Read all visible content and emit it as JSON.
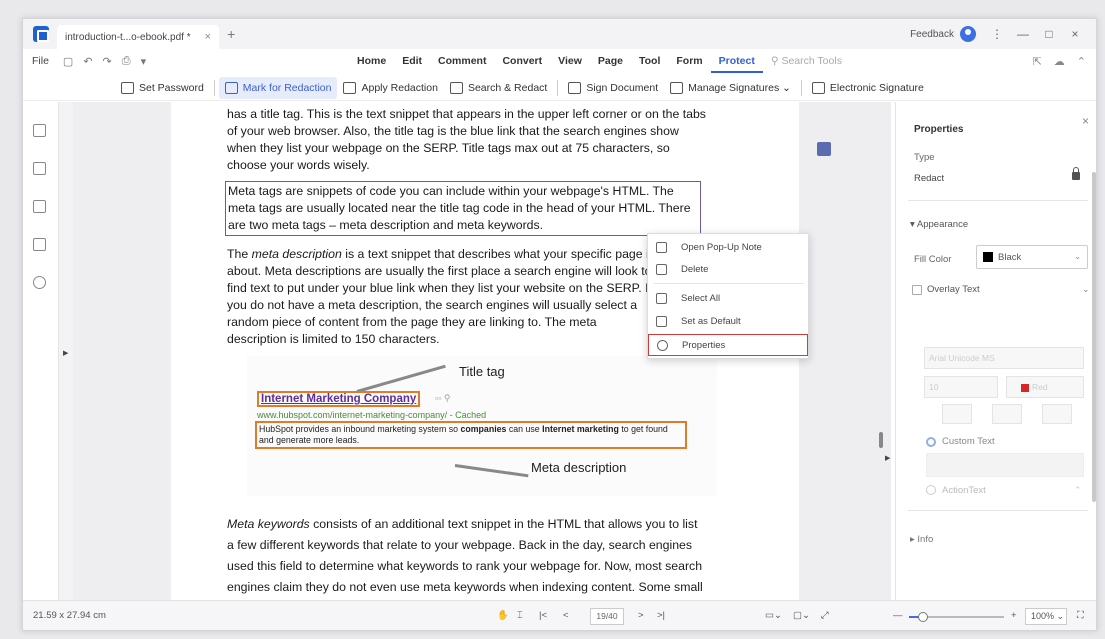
{
  "titlebar": {
    "tab_title": "introduction-t...o-ebook.pdf *",
    "tab_close": "×",
    "tab_add": "+",
    "feedback": "Feedback",
    "more": "⋮",
    "minimize": "—",
    "maximize": "□",
    "close": "×"
  },
  "menubar": {
    "file": "File",
    "items": [
      "Home",
      "Edit",
      "Comment",
      "Convert",
      "View",
      "Page",
      "Tool",
      "Form",
      "Protect"
    ],
    "active": "Protect",
    "search_tools": "Search Tools"
  },
  "ribbon": {
    "set_password": "Set Password",
    "mark_for_redaction": "Mark for Redaction",
    "apply_redaction": "Apply Redaction",
    "search_redact": "Search & Redact",
    "sign_document": "Sign Document",
    "manage_signatures": "Manage Signatures",
    "electronic_signature": "Electronic Signature"
  },
  "document": {
    "para1": "has a title tag. This is the text snippet that appears in the upper left corner or on the tabs of your web browser.  Also, the title tag is the blue link that the search engines show when they list your webpage on the SERP. Title tags max out at 75 characters, so choose your words wisely.",
    "para2": "Meta tags are snippets of code you can include within your webpage's HTML. The meta tags are usually located near the title tag code in the head of your HTML. There are two meta tags – meta description and meta keywords.",
    "para3_em": "meta description",
    "para3_pre": "The ",
    "para3_post": " is a text snippet that describes what your specific page is about. Meta descriptions are usually the first place a search engine will look to find text to put under your blue link when they list your website on the SERP. If you do not have a meta description, the search engines will usually select a random piece of content from the page they are linking to. The meta description is limited to 150 characters.",
    "para4_em": "Meta keywords",
    "para4_post": " consists of an additional text snippet in the HTML that allows you to list a few different keywords that relate to your webpage. Back in the day, search engines used this field to determine what keywords to rank your webpage for. Now, most search engines claim they do not even use meta keywords when indexing content. Some small or niche",
    "figure": {
      "title_tag_label": "Title tag",
      "meta_label": "Meta description",
      "link": "Internet Marketing Company",
      "url": "www.hubspot.com/internet-marketing-company/ - Cached",
      "desc_a": "HubSpot provides an inbound marketing system so ",
      "desc_b": "companies",
      "desc_c": " can use ",
      "desc_d": "Internet marketing",
      "desc_e": " to get found and generate more leads."
    }
  },
  "context_menu": {
    "items": [
      "Open Pop-Up Note",
      "Delete",
      "Select All",
      "Set as Default",
      "Properties"
    ],
    "selected": "Properties"
  },
  "properties": {
    "title": "Properties",
    "close": "×",
    "type_label": "Type",
    "type_value": "Redact",
    "appearance": "Appearance",
    "fill_color_label": "Fill Color",
    "fill_color_value": "Black",
    "overlay_text": "Overlay Text",
    "font": "Arial Unicode MS",
    "font_size": "10",
    "text_color": "Red",
    "custom_text": "Custom Text",
    "action_text": "ActionText",
    "info": "Info"
  },
  "statusbar": {
    "dimensions": "21.59 x 27.94 cm",
    "page": "19/40",
    "zoom": "100%",
    "zoom_level": 0.15
  }
}
